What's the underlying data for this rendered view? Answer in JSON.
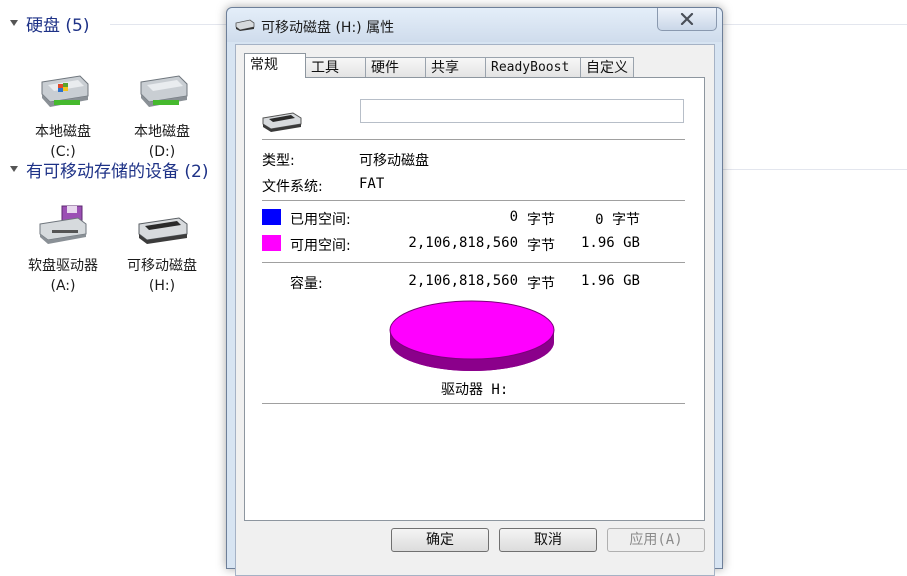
{
  "explorer": {
    "groups": [
      {
        "label": "硬盘 (5)"
      },
      {
        "label": "有可移动存储的设备 (2)"
      }
    ],
    "drives": [
      {
        "name": "本地磁盘",
        "letter": "(C:)",
        "icon": "hard-drive-windows-icon"
      },
      {
        "name": "本地磁盘",
        "letter": "(D:)",
        "icon": "hard-drive-icon"
      },
      {
        "name": "软盘驱动器",
        "letter": "(A:)",
        "icon": "floppy-drive-icon"
      },
      {
        "name": "可移动磁盘",
        "letter": "(H:)",
        "icon": "removable-drive-icon"
      }
    ]
  },
  "dialog": {
    "title": "可移动磁盘 (H:) 属性",
    "close_icon": "close-icon",
    "tabs": [
      {
        "label": "常规",
        "active": true
      },
      {
        "label": "工具"
      },
      {
        "label": "硬件"
      },
      {
        "label": "共享"
      },
      {
        "label": "ReadyBoost"
      },
      {
        "label": "自定义"
      }
    ],
    "general": {
      "name_value": "",
      "type_label": "类型:",
      "type_value": "可移动磁盘",
      "fs_label": "文件系统:",
      "fs_value": "FAT",
      "used_label": "已用空间:",
      "used_bytes": "0",
      "used_bytes_unit": "字节",
      "used_size": "0 字节",
      "free_label": "可用空间:",
      "free_bytes": "2,106,818,560",
      "free_bytes_unit": "字节",
      "free_size": "1.96 GB",
      "capacity_label": "容量:",
      "capacity_bytes": "2,106,818,560",
      "capacity_bytes_unit": "字节",
      "capacity_size": "1.96 GB",
      "drive_label": "驱动器 H:",
      "used_fraction": 0.0,
      "free_fraction": 1.0
    },
    "buttons": {
      "ok": "确定",
      "cancel": "取消",
      "apply": "应用(A)"
    }
  },
  "colors": {
    "used": "#0000ff",
    "free": "#ff00ff",
    "free_shadow": "#8b008b",
    "group_header": "#1e3287"
  }
}
